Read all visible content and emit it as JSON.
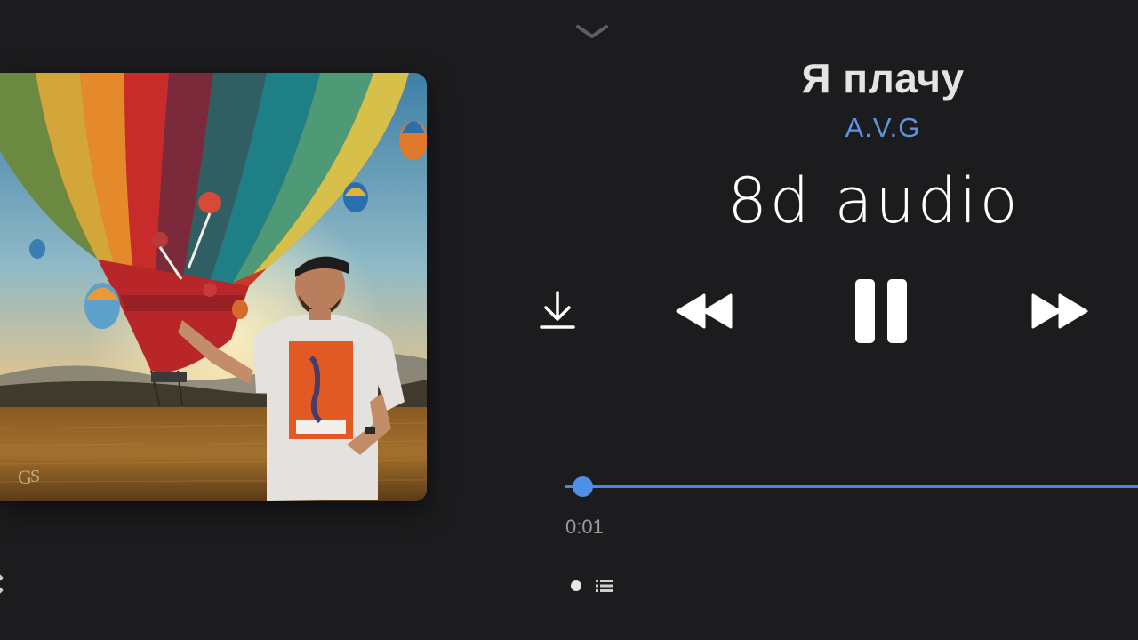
{
  "track": {
    "title": "Я плачу",
    "artist": "A.V.G"
  },
  "overlay": {
    "caption": "8d audio"
  },
  "playback": {
    "elapsed": "0:01",
    "progress_fraction": 0.003,
    "state": "playing"
  },
  "icons": {
    "collapse": "chevron-down-icon",
    "download": "download-icon",
    "previous": "rewind-icon",
    "pause": "pause-icon",
    "next": "fast-forward-icon",
    "queue": "list-icon"
  },
  "pager": {
    "pages": 2,
    "current": 0
  },
  "colors": {
    "background": "#1c1c1e",
    "accent": "#4f8fe6",
    "artist": "#5d93e0",
    "title": "#e4e4e4",
    "time": "#9a9a9c"
  }
}
